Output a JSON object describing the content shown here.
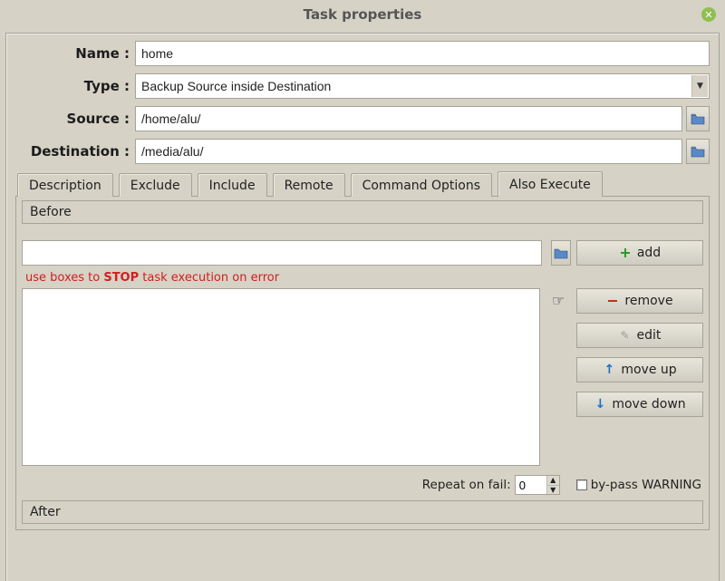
{
  "window": {
    "title": "Task properties"
  },
  "form": {
    "name_label": "Name :",
    "name_value": "home",
    "type_label": "Type :",
    "type_value": "Backup Source inside Destination",
    "source_label": "Source :",
    "source_value": "/home/alu/",
    "destination_label": "Destination :",
    "destination_value": "/media/alu/"
  },
  "tabs": [
    {
      "label": "Description",
      "active": false
    },
    {
      "label": "Exclude",
      "active": false
    },
    {
      "label": "Include",
      "active": false
    },
    {
      "label": "Remote",
      "active": false
    },
    {
      "label": "Command Options",
      "active": false
    },
    {
      "label": "Also Execute",
      "active": true
    }
  ],
  "exec": {
    "before_label": "Before",
    "command_value": "",
    "hint_prefix": "use boxes to ",
    "hint_strong": "STOP",
    "hint_suffix": " task execution on error",
    "buttons": {
      "add": "add",
      "remove": "remove",
      "edit": "edit",
      "move_up": "move up",
      "move_down": "move down"
    },
    "repeat_label": "Repeat on fail:",
    "repeat_value": "0",
    "bypass_label": "by-pass WARNING",
    "bypass_checked": false,
    "after_label": "After"
  }
}
